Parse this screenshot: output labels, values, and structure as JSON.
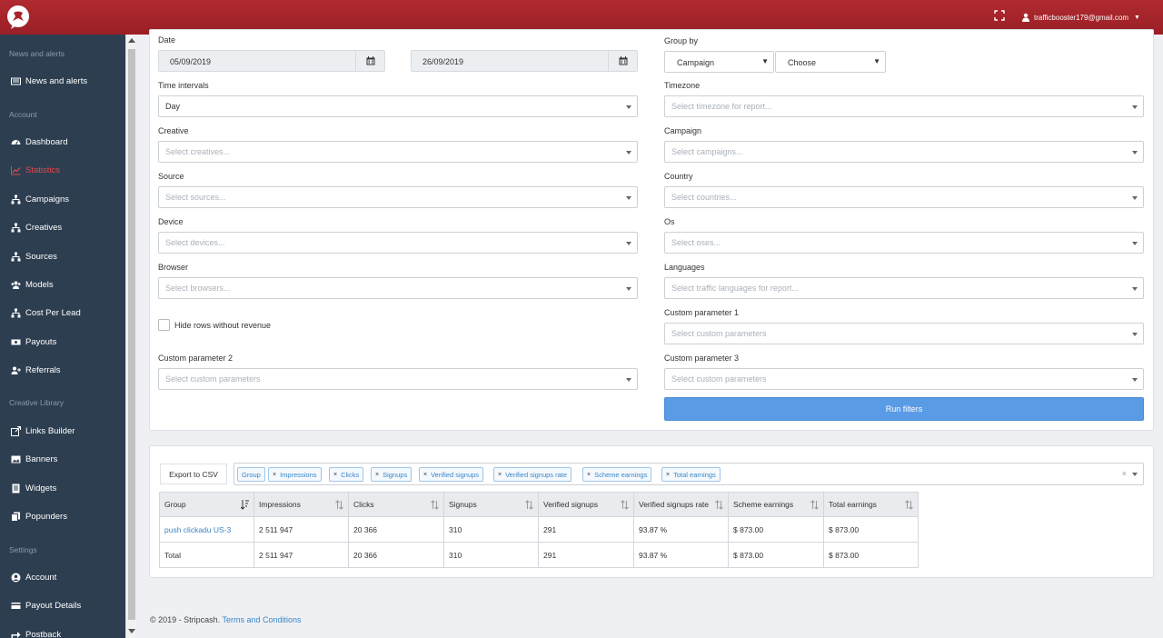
{
  "topbar": {
    "user_email": "trafficbooster179@gmail.com",
    "brand_color": "#a6242a"
  },
  "sidebar": {
    "sections": [
      {
        "title": "News and alerts",
        "items": [
          {
            "label": "News and alerts",
            "icon": "newspaper-icon"
          }
        ]
      },
      {
        "title": "Account",
        "items": [
          {
            "label": "Dashboard",
            "icon": "dashboard-icon"
          },
          {
            "label": "Statistics",
            "icon": "line-chart-icon",
            "active": true
          },
          {
            "label": "Campaigns",
            "icon": "sitemap-icon"
          },
          {
            "label": "Creatives",
            "icon": "sitemap-icon"
          },
          {
            "label": "Sources",
            "icon": "sitemap-icon"
          },
          {
            "label": "Models",
            "icon": "users-icon"
          },
          {
            "label": "Cost Per Lead",
            "icon": "sitemap-icon"
          },
          {
            "label": "Payouts",
            "icon": "money-icon"
          },
          {
            "label": "Referrals",
            "icon": "user-plus-icon"
          }
        ]
      },
      {
        "title": "Creative Library",
        "items": [
          {
            "label": "Links Builder",
            "icon": "external-link-icon"
          },
          {
            "label": "Banners",
            "icon": "image-icon"
          },
          {
            "label": "Widgets",
            "icon": "file-icon"
          },
          {
            "label": "Popunders",
            "icon": "copy-icon"
          }
        ]
      },
      {
        "title": "Settings",
        "items": [
          {
            "label": "Account",
            "icon": "user-circle-icon"
          },
          {
            "label": "Payout Details",
            "icon": "credit-card-icon"
          },
          {
            "label": "Postback",
            "icon": "share-icon"
          }
        ]
      }
    ]
  },
  "filters": {
    "date": {
      "label": "Date",
      "from": "05/09/2019",
      "to": "26/09/2019"
    },
    "group_by": {
      "label": "Group by",
      "first": "Campaign",
      "second": "Choose"
    },
    "time_intervals": {
      "label": "Time intervals",
      "value": "Day"
    },
    "timezone": {
      "label": "Timezone",
      "placeholder": "Select timezone for report..."
    },
    "creative": {
      "label": "Creative",
      "placeholder": "Select creatives..."
    },
    "campaign": {
      "label": "Campaign",
      "placeholder": "Select campaigns..."
    },
    "source": {
      "label": "Source",
      "placeholder": "Select sources..."
    },
    "country": {
      "label": "Country",
      "placeholder": "Select countries..."
    },
    "device": {
      "label": "Device",
      "placeholder": "Select devices..."
    },
    "os": {
      "label": "Os",
      "placeholder": "Select oses..."
    },
    "browser": {
      "label": "Browser",
      "placeholder": "Select browsers..."
    },
    "languages": {
      "label": "Languages",
      "placeholder": "Select traffic languages for report..."
    },
    "hide_rows": {
      "label": "Hide rows without revenue",
      "checked": false
    },
    "custom1": {
      "label": "Custom parameter 1",
      "placeholder": "Select custom parameters"
    },
    "custom2": {
      "label": "Custom parameter 2",
      "placeholder": "Select custom parameters"
    },
    "custom3": {
      "label": "Custom parameter 3",
      "placeholder": "Select custom parameters"
    },
    "run_label": "Run filters"
  },
  "results": {
    "export_label": "Export to CSV",
    "columns_tags": [
      "Impressions",
      "Clicks",
      "Signups",
      "Verified signups",
      "Verified signups rate",
      "Scheme earnings",
      "Total earnings"
    ],
    "group_tag": "Group",
    "headers": [
      "Group",
      "Impressions",
      "Clicks",
      "Signups",
      "Verified signups",
      "Verified signups rate",
      "Scheme earnings",
      "Total earnings"
    ],
    "rows": [
      [
        "push clickadu US-3",
        "2 511 947",
        "20 366",
        "310",
        "291",
        "93.87 %",
        "$ 873.00",
        "$ 873.00"
      ]
    ],
    "total": [
      "Total",
      "2 511 947",
      "20 366",
      "310",
      "291",
      "93.87 %",
      "$ 873.00",
      "$ 873.00"
    ]
  },
  "footer": {
    "copyright": "© 2019 - Stripcash.",
    "terms": "Terms and Conditions"
  }
}
